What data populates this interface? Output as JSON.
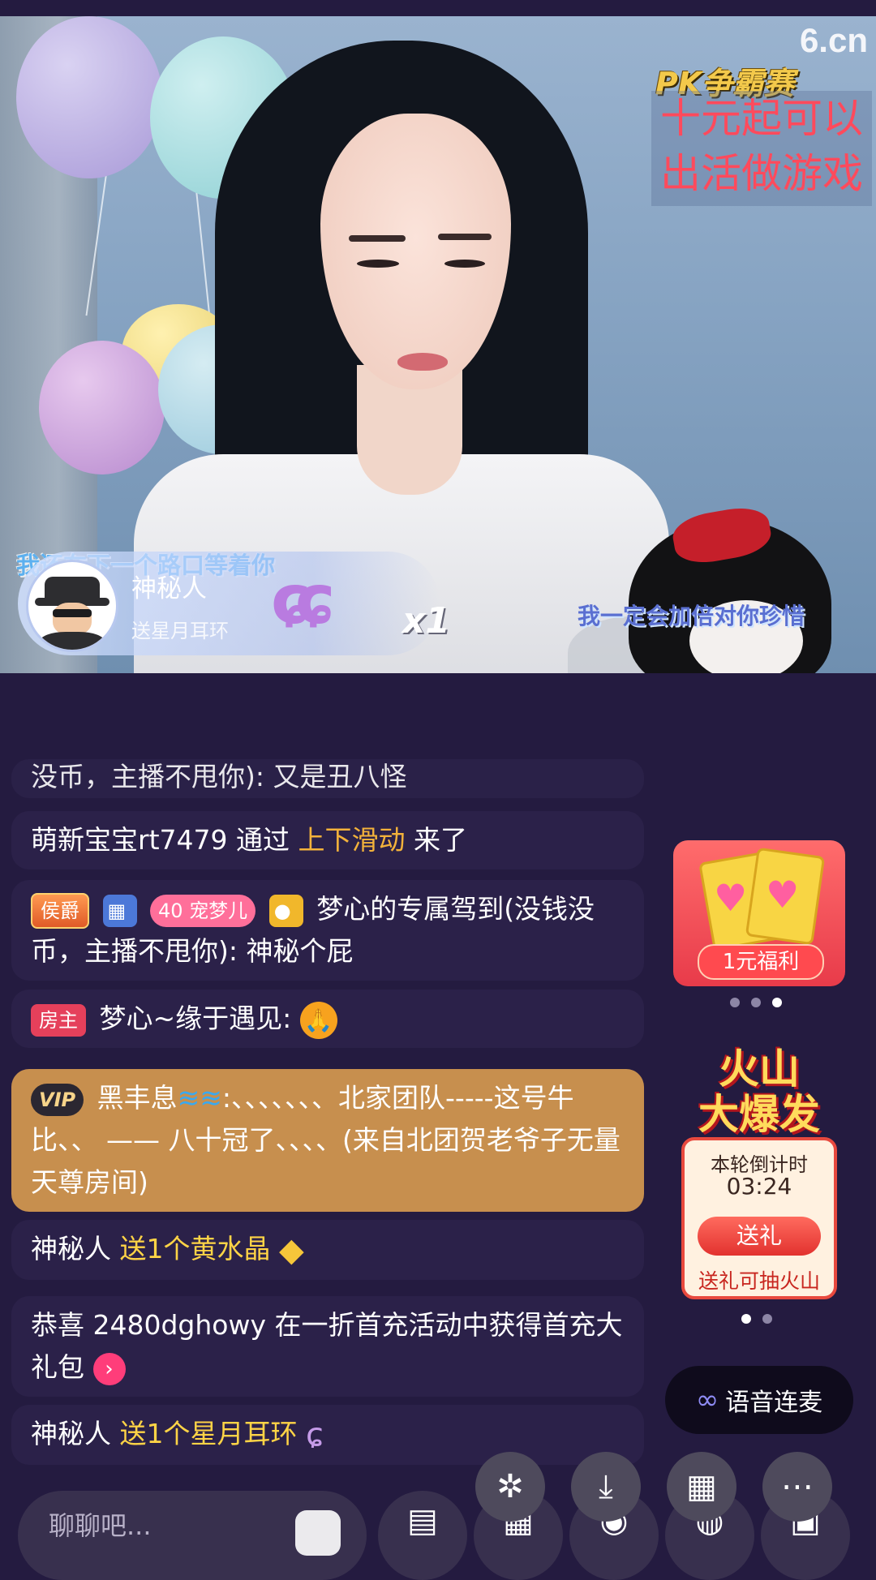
{
  "video": {
    "watermark": "6.cn",
    "pk_badge": "PK争霸赛",
    "promo_text_line1": "十元起可以",
    "promo_text_line2": "出活做游戏",
    "lyric_left": "我还在下一个路口等着你",
    "lyric_right": "我一定会加倍对你珍惜",
    "gift_banner": {
      "user": "神秘人",
      "desc": "送星月耳环",
      "count": "x1"
    }
  },
  "chat": {
    "partial_top": "没币，主播不甩你): 又是丑八怪",
    "m1": {
      "user": "萌新宝宝rt7479",
      "mid": " 通过 ",
      "action": "上下滑动",
      "tail": " 来了"
    },
    "m2": {
      "badge_rank": "侯爵",
      "badge_level": "40",
      "badge_pet": "宠梦儿",
      "text": "梦心的专属驾到(没钱没币，主播不甩你): 神秘个屁"
    },
    "m3": {
      "badge": "房主",
      "text": "梦心~缘于遇见: "
    },
    "m4": {
      "badge": "VIP",
      "user": "黑丰息",
      "text": ":、、、、、、、北家团队-----这号牛比、、 —— 八十冠了、、、、(来自北团贺老爷子无量天尊房间)"
    },
    "m5": {
      "user": "神秘人",
      "gift": " 送1个黄水晶"
    },
    "m6": {
      "text": "恭喜 2480dghowy 在一折首充活动中获得首充大礼包"
    },
    "m7": {
      "user": "神秘人",
      "gift": " 送1个星月耳环"
    }
  },
  "right": {
    "welfare_label": "1元福利",
    "volcano_title_1": "火山",
    "volcano_title_2": "大爆发",
    "countdown_label": "本轮倒计时",
    "countdown_time": "03:24",
    "send_label": "送礼",
    "tip": "送礼可抽火山",
    "voice_label": "语音连麦"
  },
  "input": {
    "placeholder": "聊聊吧..."
  },
  "colors": {
    "bg": "#241b40",
    "highlight_yellow": "#ffd446",
    "highlight_orange": "#f3b23b",
    "vip_bg": "#c78f4e"
  }
}
